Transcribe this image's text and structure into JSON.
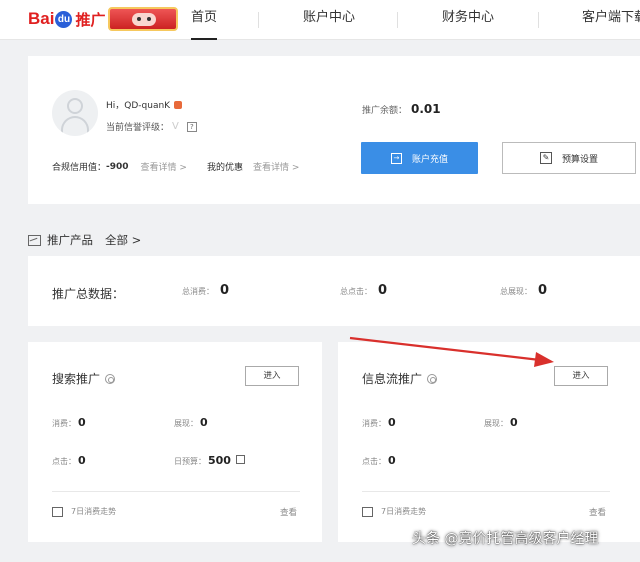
{
  "nav": {
    "items": [
      {
        "label": "首页",
        "active": true
      },
      {
        "label": "账户中心"
      },
      {
        "label": "财务中心"
      },
      {
        "label": "客户端下载"
      }
    ]
  },
  "logo": {
    "bai": "Bai",
    "du": "du",
    "suffix": "推广"
  },
  "account": {
    "greeting": "Hi，QD-quanK",
    "credit_level_label": "当前信誉评级：",
    "credit_level_value": "V",
    "help_icon": "?",
    "compliance_label": "合规信用值：",
    "compliance_value": "-900",
    "view_details": "查看详情 >",
    "offers_label": "我的优惠",
    "offers_view_details": "查看详情 >",
    "balance_label": "推广余额：",
    "balance_value": "0.01",
    "recharge_button": "账户充值",
    "budget_button": "预算设置"
  },
  "products_section": {
    "title": "推广产品",
    "filter": "全部 >"
  },
  "totals": {
    "title": "推广总数据：",
    "spend_label": "总消费：",
    "spend_value": "0",
    "clicks_label": "总点击：",
    "clicks_value": "0",
    "impressions_label": "总展现：",
    "impressions_value": "0"
  },
  "search_promo": {
    "title": "搜索推广",
    "enter_button": "进入",
    "spend_label": "消费：",
    "spend_value": "0",
    "impressions_label": "展现：",
    "impressions_value": "0",
    "clicks_label": "点击：",
    "clicks_value": "0",
    "budget_label": "日预算：",
    "budget_value": "500",
    "trend_label": "7日消费走势",
    "view_link": "查看"
  },
  "feed_promo": {
    "title": "信息流推广",
    "enter_button": "进入",
    "spend_label": "消费：",
    "spend_value": "0",
    "impressions_label": "展现：",
    "impressions_value": "0",
    "clicks_label": "点击：",
    "clicks_value": "0",
    "trend_label": "7日消费走势",
    "view_link": "查看"
  },
  "watermark": "头条 @竞价托管高级客户经理",
  "colors": {
    "primary_button": "#3a8ee6",
    "arrow": "#d9302c",
    "logo_red": "#e02020",
    "logo_blue": "#2a5fd8"
  },
  "icons": [
    "user-avatar-icon",
    "help-icon",
    "recharge-icon",
    "edit-budget-icon",
    "chart-icon",
    "gear-icon",
    "edit-icon",
    "trend-chart-icon"
  ]
}
